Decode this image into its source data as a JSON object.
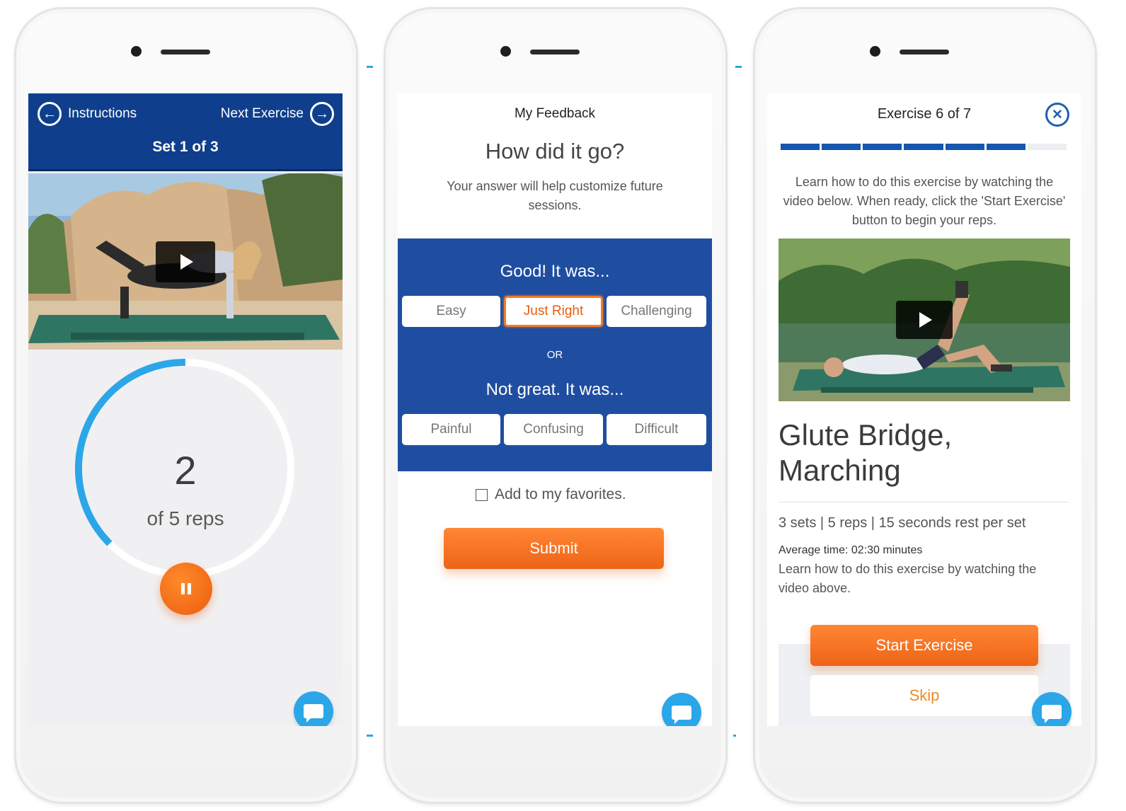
{
  "phone1": {
    "nav_left_label": "Instructions",
    "nav_right_label": "Next Exercise",
    "set_label": "Set 1 of 3",
    "rep_count": "2",
    "rep_label": "of 5 reps",
    "rep_progress": 0.4
  },
  "phone2": {
    "title": "My Feedback",
    "heading": "How did it go?",
    "subheading": "Your answer will help customize future sessions.",
    "good_label": "Good! It was...",
    "good_options": [
      "Easy",
      "Just Right",
      "Challenging"
    ],
    "selected_option": "Just Right",
    "or_label": "OR",
    "bad_label": "Not great. It was...",
    "bad_options": [
      "Painful",
      "Confusing",
      "Difficult"
    ],
    "favorites_label": "Add to my favorites.",
    "favorites_checked": false,
    "submit_label": "Submit"
  },
  "phone3": {
    "title": "Exercise 6 of 7",
    "progress_segments_done": 6,
    "progress_segments_total": 7,
    "intro": "Learn how to do this exercise by watching the video below. When ready, click the 'Start Exercise' button to begin your reps.",
    "exercise_name_line1": "Glute Bridge,",
    "exercise_name_line2": "Marching",
    "meta": "3 sets | 5 reps | 15 seconds rest per set",
    "average_time": "Average time: 02:30 minutes",
    "description": "Learn how to do this exercise by watching the video above.",
    "start_label": "Start Exercise",
    "skip_label": "Skip"
  },
  "colors": {
    "header_blue": "#0f3f8c",
    "panel_blue": "#1f4ea1",
    "progress_blue": "#1457ad",
    "accent_orange": "#ee6417",
    "ring_blue": "#2ba6e8",
    "chat_blue": "#2ba6e8"
  },
  "icons": {
    "nav_left": "arrow-left-circle-icon",
    "nav_right": "arrow-right-circle-icon",
    "video": "play-icon",
    "pause": "pause-icon",
    "chat": "chat-bubble-icon",
    "close": "close-circle-icon",
    "favorites": "checkbox-icon"
  }
}
